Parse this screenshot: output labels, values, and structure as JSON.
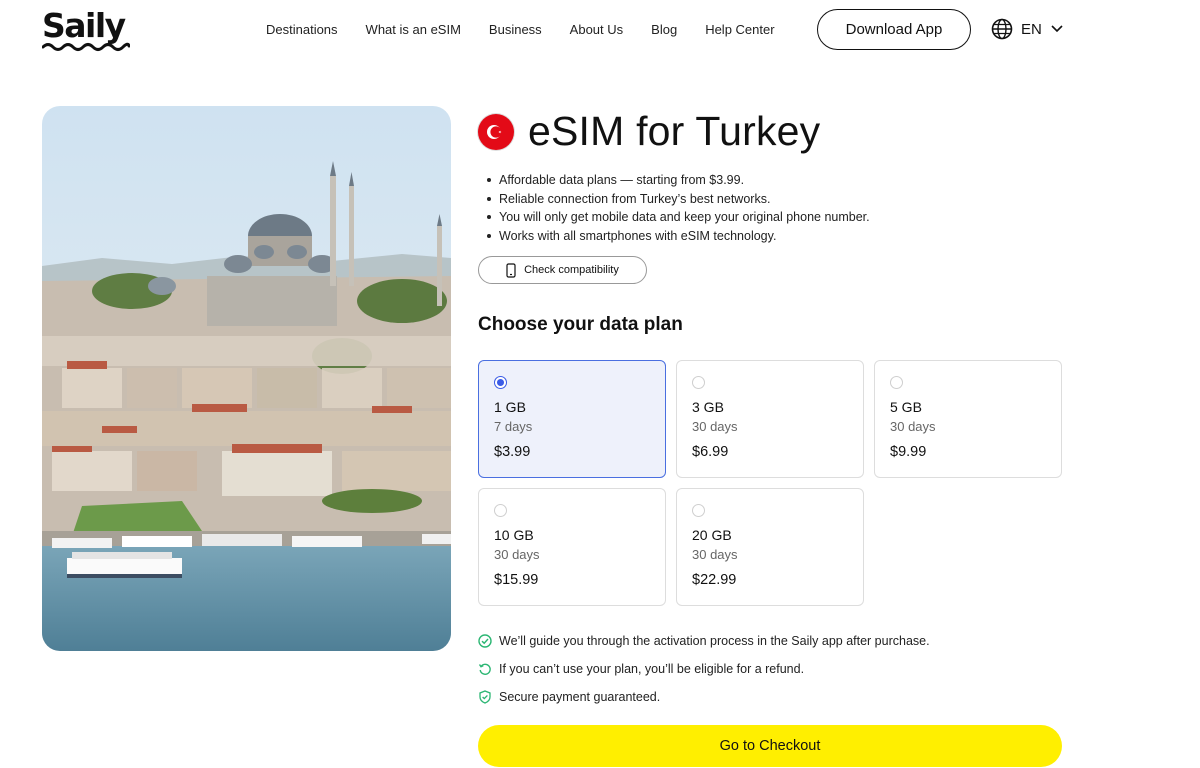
{
  "brand": {
    "name": "Saily"
  },
  "nav": {
    "items": [
      {
        "label": "Destinations"
      },
      {
        "label": "What is an eSIM"
      },
      {
        "label": "Business"
      },
      {
        "label": "About Us"
      },
      {
        "label": "Blog"
      },
      {
        "label": "Help Center"
      }
    ],
    "download_label": "Download App",
    "language": "EN"
  },
  "product": {
    "title": "eSIM for Turkey",
    "flag_icon": "turkey-flag-icon",
    "bullets": [
      "Affordable data plans — starting from $3.99.",
      "Reliable connection from Turkey’s best networks.",
      "You will only get mobile data and keep your original phone number.",
      "Works with all smartphones with eSIM technology."
    ],
    "check_label": "Check compatibility"
  },
  "plans": {
    "heading": "Choose your data plan",
    "items": [
      {
        "gb": "1 GB",
        "days": "7 days",
        "price": "$3.99",
        "selected": true
      },
      {
        "gb": "3 GB",
        "days": "30 days",
        "price": "$6.99",
        "selected": false
      },
      {
        "gb": "5 GB",
        "days": "30 days",
        "price": "$9.99",
        "selected": false
      },
      {
        "gb": "10 GB",
        "days": "30 days",
        "price": "$15.99",
        "selected": false
      },
      {
        "gb": "20 GB",
        "days": "30 days",
        "price": "$22.99",
        "selected": false
      }
    ]
  },
  "features": [
    {
      "icon": "check-circle-icon",
      "text": "We’ll guide you through the activation process in the Saily app after purchase."
    },
    {
      "icon": "refund-icon",
      "text": "If you can’t use your plan, you’ll be eligible for a refund."
    },
    {
      "icon": "shield-check-icon",
      "text": "Secure payment guaranteed."
    }
  ],
  "checkout_label": "Go to Checkout",
  "colors": {
    "accent_yellow": "#ffef00",
    "selected_blue": "#3b5ce6",
    "feature_green": "#2bb673"
  }
}
